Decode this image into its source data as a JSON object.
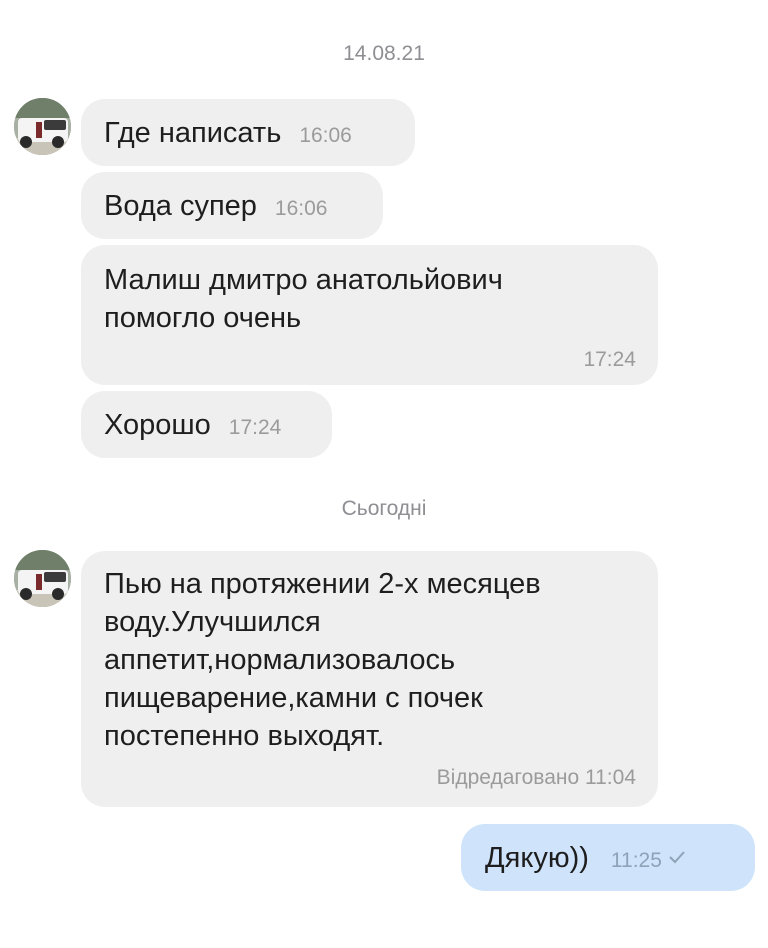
{
  "chat": {
    "date_separators": [
      "14.08.21",
      "Сьогодні"
    ],
    "messages": [
      {
        "text": "Где написать",
        "time": "16:06"
      },
      {
        "text": "Вода супер",
        "time": "16:06"
      },
      {
        "lines": [
          "Малиш дмитро анатольйович",
          "помогло очень"
        ],
        "time": "17:24"
      },
      {
        "text": "Хорошо",
        "time": "17:24"
      },
      {
        "lines": [
          "Пью на протяжении  2-х  месяцев",
          "воду.Улучшился",
          "аппетит,нормализовалось",
          "пищеварение,камни с почек",
          "постепенно выходят."
        ],
        "time": "Відредаговано 11:04"
      }
    ],
    "outgoing": {
      "text": "Дякую))",
      "time": "11:25",
      "status_icon": "single-check-icon"
    },
    "colors": {
      "incoming_bubble": "#efefef",
      "outgoing_bubble": "#cfe4fb",
      "meta_text": "#9b9b9b"
    }
  }
}
